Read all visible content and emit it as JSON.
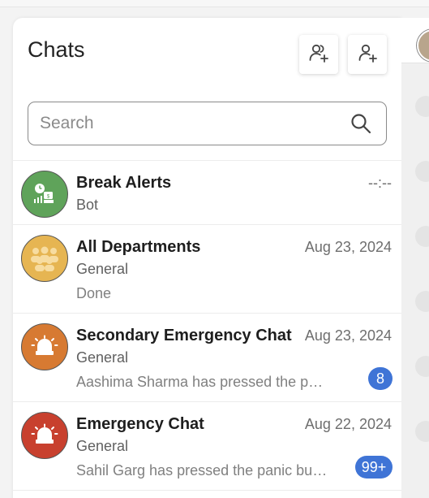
{
  "header": {
    "title": "Chats"
  },
  "search": {
    "placeholder": "Search"
  },
  "chats": [
    {
      "name": "Break Alerts",
      "subtitle": "Bot",
      "date": "--:--",
      "last_message": "",
      "unread": ""
    },
    {
      "name": "All Departments",
      "subtitle": "General",
      "date": "Aug 23, 2024",
      "last_message": "Done",
      "unread": ""
    },
    {
      "name": "Secondary Emergency Chat",
      "subtitle": "General",
      "date": "Aug 23, 2024",
      "last_message": "Aashima Sharma has pressed the panic button",
      "unread": "8"
    },
    {
      "name": "Emergency Chat",
      "subtitle": "General",
      "date": "Aug 22, 2024",
      "last_message": "Sahil Garg has pressed the panic button",
      "unread": "99+"
    }
  ],
  "icons": {
    "new_group": "add-group-icon",
    "new_chat": "add-user-icon",
    "search": "search-icon"
  },
  "colors": {
    "badge": "#3f74d6",
    "break_alerts_avatar": "#5fa35a",
    "departments_avatar": "#e6b552",
    "secondary_emergency_avatar": "#d77a32",
    "emergency_avatar": "#c8402e"
  }
}
